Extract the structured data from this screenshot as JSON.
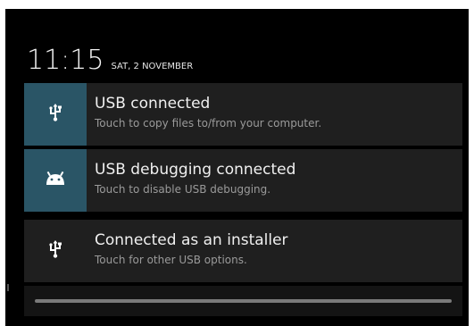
{
  "header": {
    "time": "11:15",
    "date": "SAT, 2 NOVEMBER"
  },
  "notifications": [
    {
      "icon": "usb-icon",
      "title": "USB connected",
      "subtitle": "Touch to copy files to/from your computer."
    },
    {
      "icon": "android-icon",
      "title": "USB debugging connected",
      "subtitle": "Touch to disable USB debugging."
    },
    {
      "icon": "usb-icon",
      "title": "Connected as an installer",
      "subtitle": "Touch for other USB options."
    }
  ],
  "colors": {
    "background": "#000000",
    "card": "#1f1f1f",
    "icon_highlight": "#2a5566",
    "title_text": "#f0f0f0",
    "subtitle_text": "#9a9a9a"
  }
}
